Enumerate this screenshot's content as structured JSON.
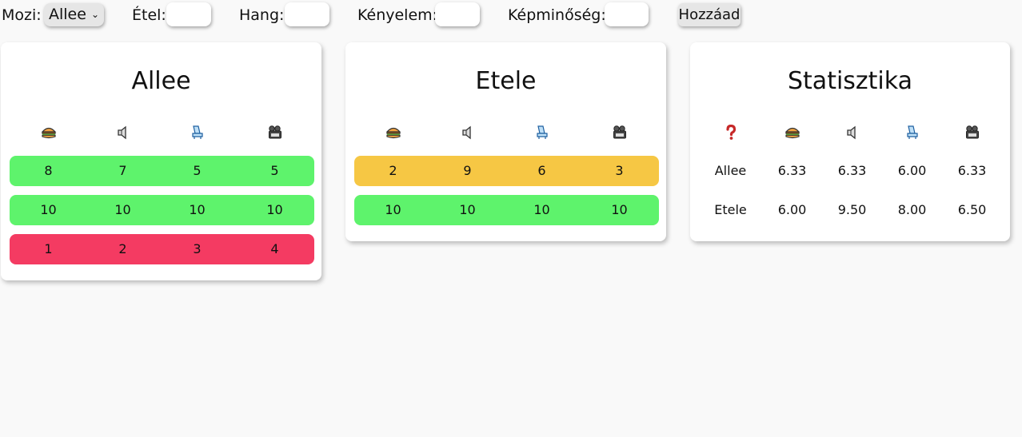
{
  "toolbar": {
    "mozi_label": "Mozi:",
    "mozi_selected": "Allee",
    "etel_label": "Étel:",
    "hang_label": "Hang:",
    "kenyelem_label": "Kényelem:",
    "kepminoseg_label": "Képminőség:",
    "add_button": "Hozzáad"
  },
  "icons": {
    "food": "burger-icon",
    "sound": "speaker-icon",
    "comfort": "seat-icon",
    "picture": "projector-icon",
    "cinema": "question-icon"
  },
  "colors": {
    "green": "#5ef36c",
    "yellow": "#f6c744",
    "red": "#f43b62"
  },
  "cards": [
    {
      "title": "Allee",
      "rows": [
        {
          "color": "green",
          "values": [
            "8",
            "7",
            "5",
            "5"
          ]
        },
        {
          "color": "green",
          "values": [
            "10",
            "10",
            "10",
            "10"
          ]
        },
        {
          "color": "red",
          "values": [
            "1",
            "2",
            "3",
            "4"
          ]
        }
      ]
    },
    {
      "title": "Etele",
      "rows": [
        {
          "color": "yellow",
          "values": [
            "2",
            "9",
            "6",
            "3"
          ]
        },
        {
          "color": "green",
          "values": [
            "10",
            "10",
            "10",
            "10"
          ]
        }
      ]
    }
  ],
  "stats": {
    "title": "Statisztika",
    "rows": [
      {
        "name": "Allee",
        "values": [
          "6.33",
          "6.33",
          "6.00",
          "6.33"
        ]
      },
      {
        "name": "Etele",
        "values": [
          "6.00",
          "9.50",
          "8.00",
          "6.50"
        ]
      }
    ]
  }
}
